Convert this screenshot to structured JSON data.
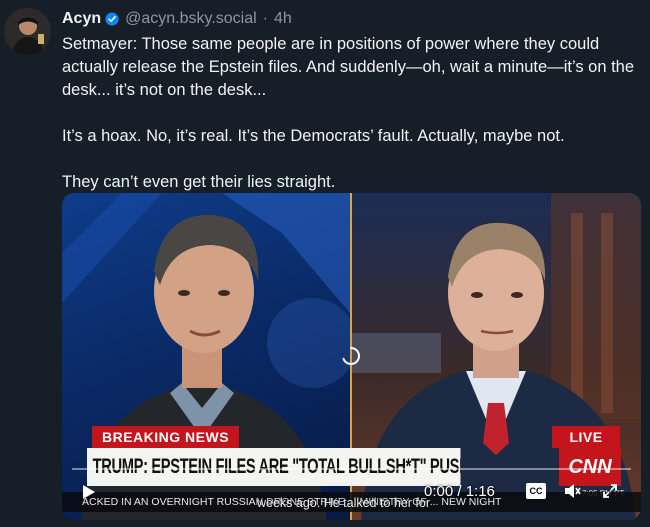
{
  "post": {
    "author": {
      "name": "Acyn",
      "handle": "@acyn.bsky.social",
      "separator": "·",
      "time": "4h"
    },
    "paragraphs": [
      "Setmayer: Those same people are in positions of power where they could actually release the Epstein files. And suddenly—oh, wait a minute—it’s on the desk... it’s not on the desk...",
      "It’s a hoax. No, it’s real. It’s the Democrats’ fault. Actually, maybe not.",
      "They can’t even get their lies straight."
    ]
  },
  "video": {
    "breaking_label": "BREAKING NEWS",
    "live_label": "LIVE",
    "headline": "TRUMP: EPSTEIN FILES ARE \"TOTAL BULLSH*T\" PUSHED BY DEMS",
    "network": "CNN",
    "clock": "7:05 PM PT",
    "ticker": "ACKED IN AN OVERNIGHT RUSSIAN DRONE STRIKE ... MINISTRY OF ... NEW NIGHT",
    "caption": "weeks ago. He talked to her for",
    "time_display": "0:00 / 1:16",
    "cc_label": "CC",
    "progress": 0,
    "icons": [
      "play-icon",
      "captions-icon",
      "mute-icon",
      "fullscreen-icon",
      "loading-spinner-icon",
      "verified-badge-icon"
    ],
    "accent_colors": {
      "cnn_red": "#c3151b",
      "verified_blue": "#1185fe",
      "divider_gold": "#d9a441"
    }
  }
}
